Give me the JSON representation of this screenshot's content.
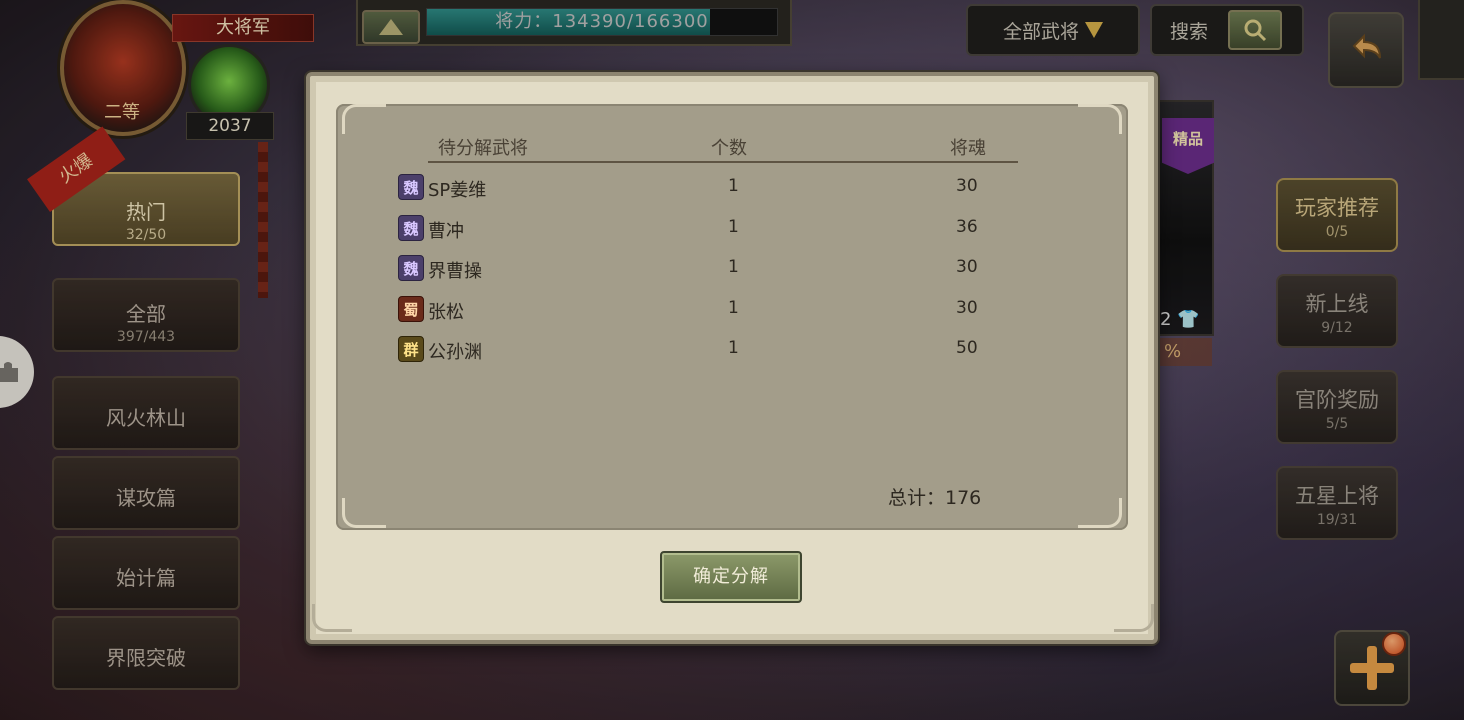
{
  "hud": {
    "rank_title": "大将军",
    "rank_level": "二等",
    "orb_count": "2037",
    "power_text": "将力：134390/166300",
    "power_fraction": 0.808
  },
  "top_bar": {
    "filter_label": "全部武将",
    "search_placeholder": "搜索"
  },
  "left_menu": {
    "hot_ribbon": "火爆",
    "tabs": [
      {
        "label": "热门",
        "sub": "32/50"
      },
      {
        "label": "全部",
        "sub": "397/443"
      },
      {
        "label": "风火林山",
        "sub": ""
      },
      {
        "label": "谋攻篇",
        "sub": ""
      },
      {
        "label": "始计篇",
        "sub": ""
      },
      {
        "label": "界限突破",
        "sub": ""
      }
    ]
  },
  "right_menu": {
    "tabs": [
      {
        "label": "玩家推荐",
        "sub": "0/5"
      },
      {
        "label": "新上线",
        "sub": "9/12"
      },
      {
        "label": "官阶奖励",
        "sub": "5/5"
      },
      {
        "label": "五星上将",
        "sub": "19/31"
      }
    ]
  },
  "background_card": {
    "tag": "精品",
    "count": "2",
    "percent": "%"
  },
  "dialog": {
    "columns": {
      "general": "待分解武将",
      "count": "个数",
      "soul": "将魂"
    },
    "rows": [
      {
        "faction": "魏",
        "faction_key": "wei",
        "name": "SP姜维",
        "count": "1",
        "soul": "30"
      },
      {
        "faction": "魏",
        "faction_key": "wei",
        "name": "曹冲",
        "count": "1",
        "soul": "36"
      },
      {
        "faction": "魏",
        "faction_key": "wei",
        "name": "界曹操",
        "count": "1",
        "soul": "30"
      },
      {
        "faction": "蜀",
        "faction_key": "shu",
        "name": "张松",
        "count": "1",
        "soul": "30"
      },
      {
        "faction": "群",
        "faction_key": "qun",
        "name": "公孙渊",
        "count": "1",
        "soul": "50"
      }
    ],
    "total_text": "总计：176",
    "confirm_label": "确定分解"
  }
}
